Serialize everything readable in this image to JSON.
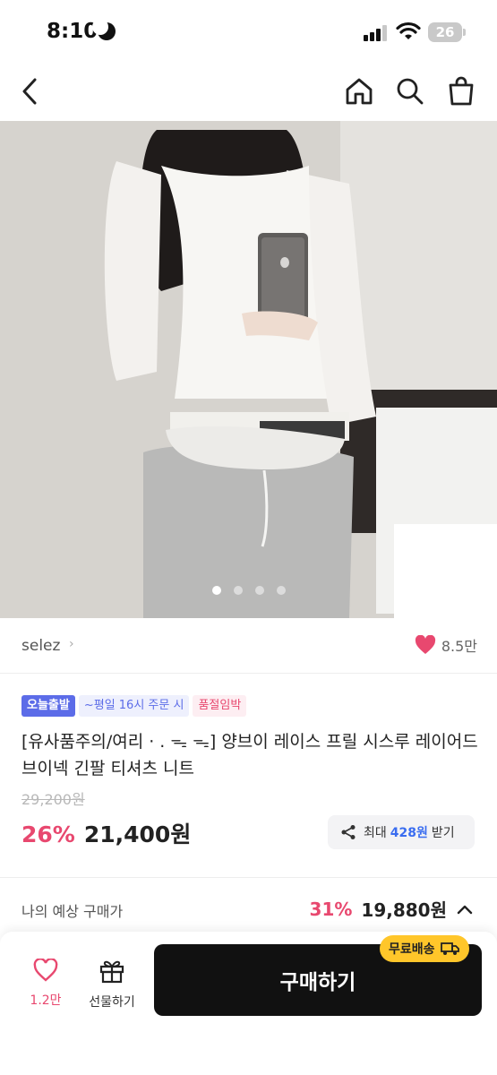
{
  "status_bar": {
    "time": "8:10",
    "battery": "26"
  },
  "product": {
    "image_alt": "model wearing white lace see-through v-neck top",
    "carousel": {
      "count": 4,
      "active": 0
    },
    "seller": "selez",
    "likes": "8.5만",
    "badges": {
      "today": "오늘출발",
      "order": "~평일 16시 주문 시",
      "soldout": "품절임박"
    },
    "title": "[유사품주의/여리 · . ᯓ ᯓ] 양브이 레이스 프릴 시스루 레이어드 브이넥 긴팔 티셔츠 니트",
    "original_price": "29,200원",
    "discount": "26%",
    "price": "21,400원",
    "coupon": {
      "prefix": "최대",
      "amount": "428원",
      "suffix": "받기"
    },
    "expected": {
      "label": "나의 예상 구매가",
      "discount": "31%",
      "price": "19,880원"
    }
  },
  "bottom_bar": {
    "like_count": "1.2만",
    "gift_label": "선물하기",
    "buy_label": "구매하기",
    "free_shipping": "무료배송"
  },
  "colors": {
    "accent_pink": "#e8486f",
    "badge_blue": "#5c6ce8",
    "coupon_blue": "#3a6df0",
    "ship_yellow": "#ffc62a"
  }
}
